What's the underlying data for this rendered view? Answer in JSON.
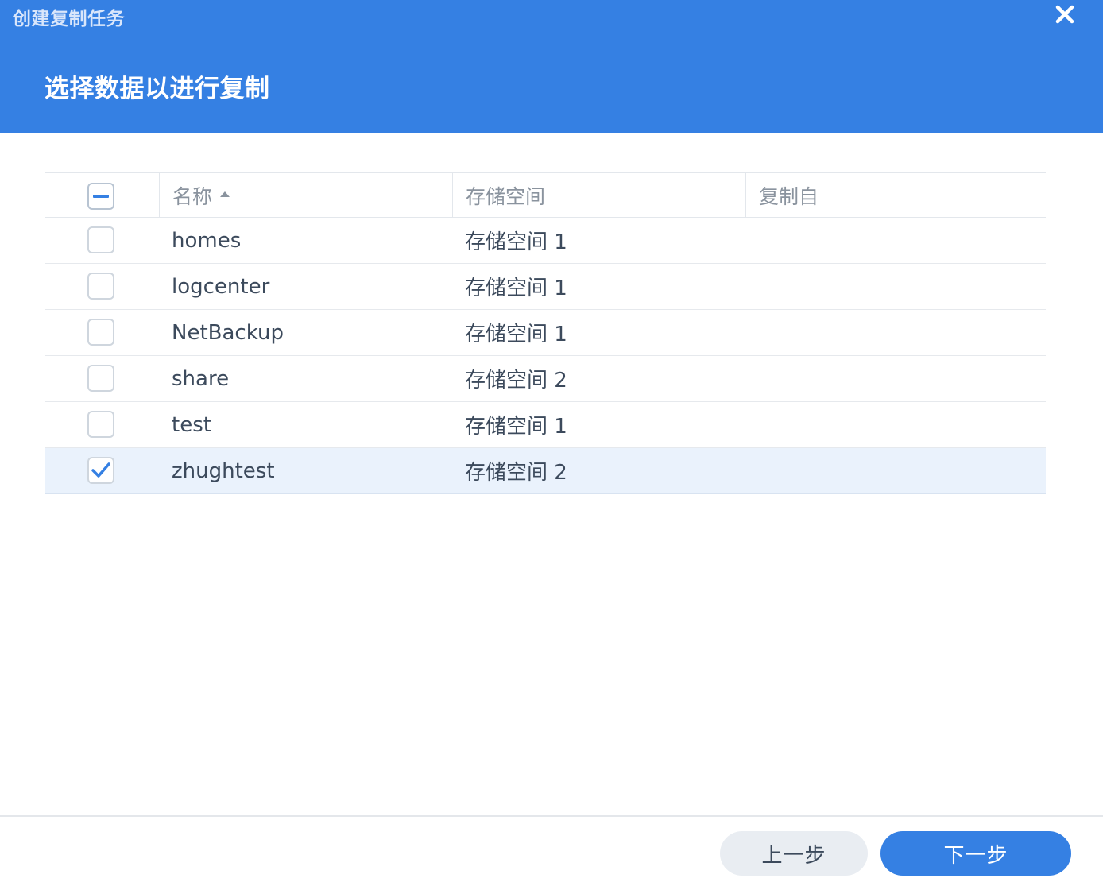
{
  "window": {
    "title": "创建复制任务",
    "close_icon": "close-icon"
  },
  "step": {
    "title": "选择数据以进行复制"
  },
  "table": {
    "columns": [
      {
        "label": "名称",
        "sorted": "ascending"
      },
      {
        "label": "存储空间"
      },
      {
        "label": "复制自"
      }
    ],
    "select_all_state": "partial",
    "rows": [
      {
        "name": "homes",
        "volume": "存储空间 1",
        "source": "",
        "checked": false
      },
      {
        "name": "logcenter",
        "volume": "存储空间 1",
        "source": "",
        "checked": false
      },
      {
        "name": "NetBackup",
        "volume": "存储空间 1",
        "source": "",
        "checked": false
      },
      {
        "name": "share",
        "volume": "存储空间 2",
        "source": "",
        "checked": false
      },
      {
        "name": "test",
        "volume": "存储空间 1",
        "source": "",
        "checked": false
      },
      {
        "name": "zhughtest",
        "volume": "存储空间 2",
        "source": "",
        "checked": true
      }
    ]
  },
  "footer": {
    "prev_label": "上一步",
    "next_label": "下一步"
  },
  "colors": {
    "accent": "#3580e3",
    "selected_row": "#eaf2fc",
    "header_text": "#8a939e"
  }
}
